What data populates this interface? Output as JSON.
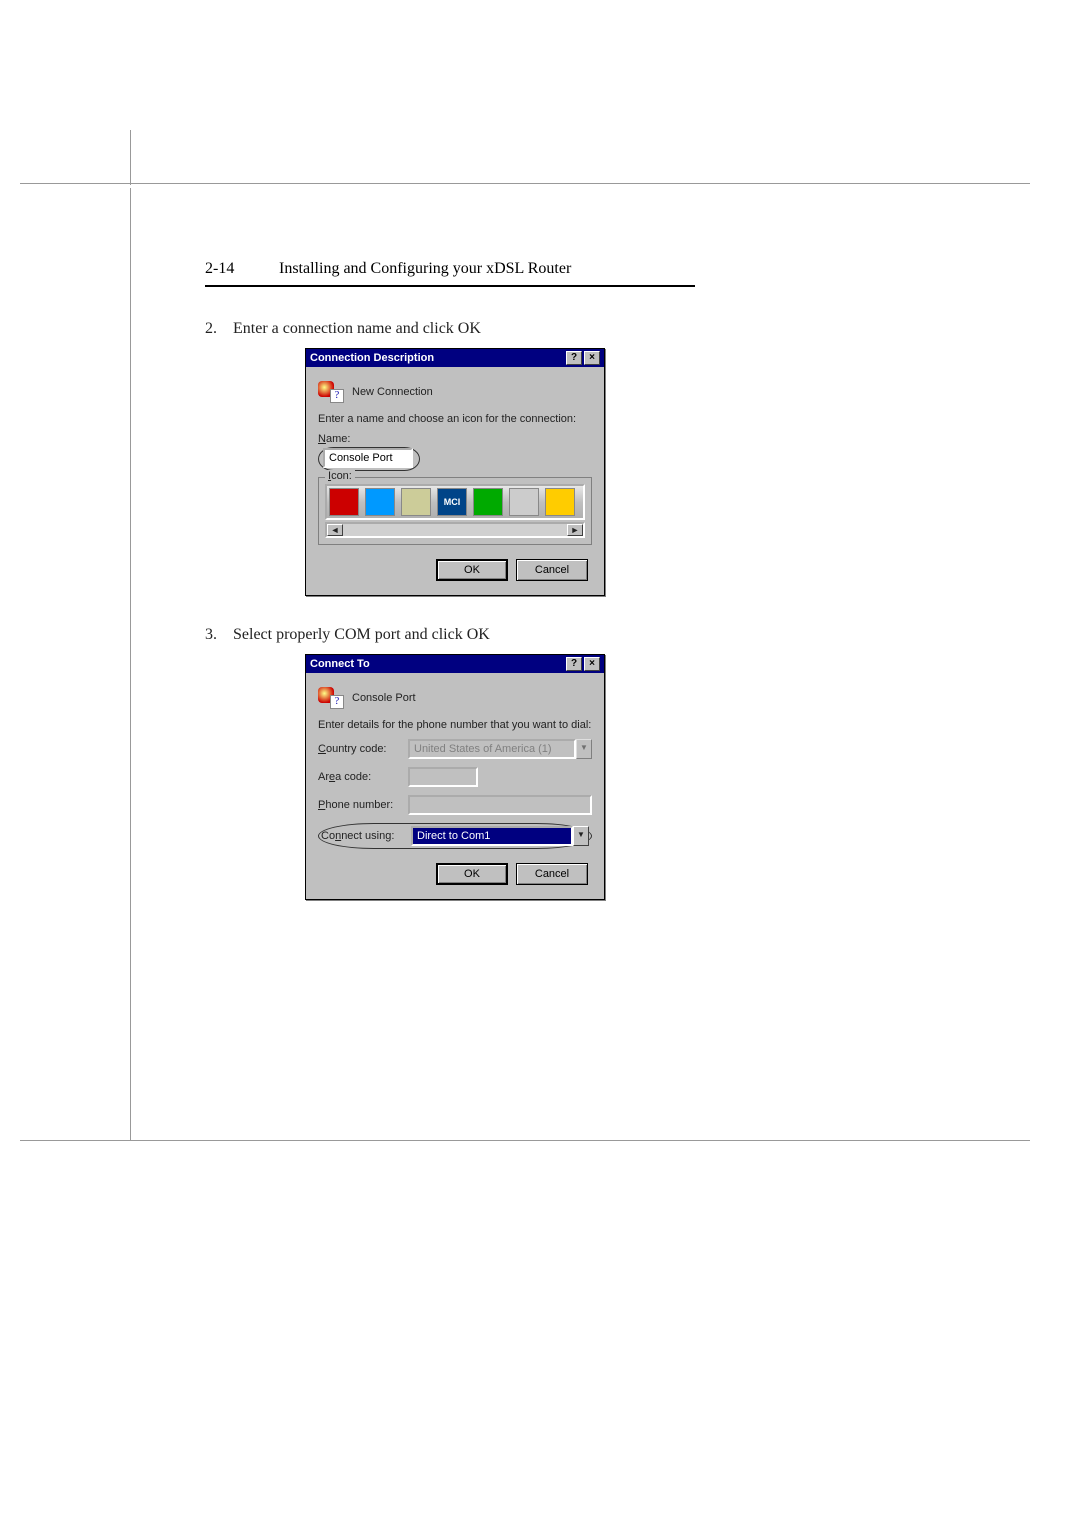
{
  "header": {
    "page_number": "2-14",
    "title": "Installing and Configuring your xDSL Router"
  },
  "steps": {
    "s2": {
      "num": "2.",
      "text": "Enter a connection name and click OK"
    },
    "s3": {
      "num": "3.",
      "text": "Select properly COM port and click OK"
    }
  },
  "dialog1": {
    "title": "Connection Description",
    "heading": "New Connection",
    "instruction": "Enter a name and choose an icon for the connection:",
    "name_label_u": "N",
    "name_label_rest": "ame:",
    "name_value": "Console Port",
    "icon_label_u": "I",
    "icon_label_rest": "con:",
    "icons": {
      "mci": "MCI"
    },
    "ok": "OK",
    "cancel": "Cancel"
  },
  "dialog2": {
    "title": "Connect To",
    "heading": "Console Port",
    "instruction": "Enter details for the phone number that you want to dial:",
    "country_u": "C",
    "country_rest": "ountry code:",
    "country_value": "United States of America (1)",
    "area_pre": "Ar",
    "area_u": "e",
    "area_rest": "a code:",
    "area_value": "",
    "phone_u": "P",
    "phone_rest": "hone number:",
    "phone_value": "",
    "connect_pre": "Co",
    "connect_u": "n",
    "connect_rest": "nect using:",
    "connect_value": "Direct to Com1",
    "ok": "OK",
    "cancel": "Cancel"
  }
}
